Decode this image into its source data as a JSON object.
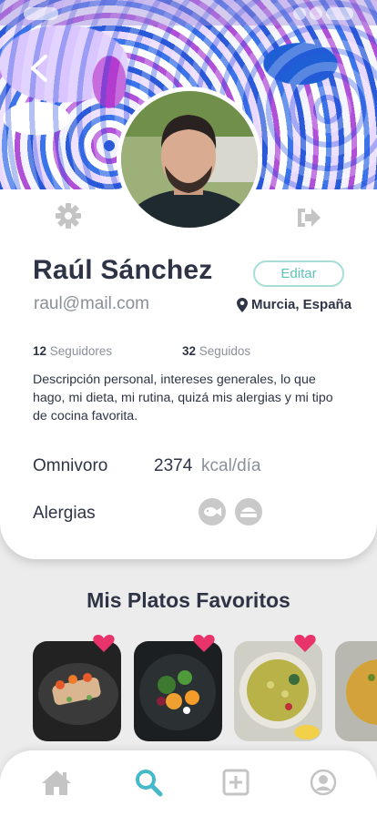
{
  "profile": {
    "name": "Raúl Sánchez",
    "edit_label": "Editar",
    "email": "raul@mail.com",
    "location": "Murcia, España",
    "followers_count": "12",
    "followers_label": "Seguidores",
    "following_count": "32",
    "following_label": "Seguidos",
    "description": "Descripción personal, intereses generales, lo que hago, mi dieta, mi rutina, quizá mis alergias y mi tipo de cocina favorita.",
    "diet": "Omnivoro",
    "kcal_value": "2374",
    "kcal_unit": "kcal/día",
    "allergies_label": "Alergias",
    "allergy_icons": [
      "fish-icon",
      "dairy-icon"
    ]
  },
  "favorites": {
    "title": "Mis Platos Favoritos",
    "dishes": [
      {
        "icon": "dish-photo",
        "favorited": true
      },
      {
        "icon": "dish-photo",
        "favorited": true
      },
      {
        "icon": "dish-photo",
        "favorited": true
      },
      {
        "icon": "dish-photo",
        "favorited": false
      }
    ]
  },
  "nav": {
    "items": [
      "home-icon",
      "search-icon",
      "add-icon",
      "profile-icon"
    ],
    "active": "search-icon"
  },
  "colors": {
    "accent": "#45b8c9",
    "text": "#2e3445",
    "muted": "#8b8f99",
    "heart": "#e8336b",
    "edit_border": "#a7ddd6"
  }
}
